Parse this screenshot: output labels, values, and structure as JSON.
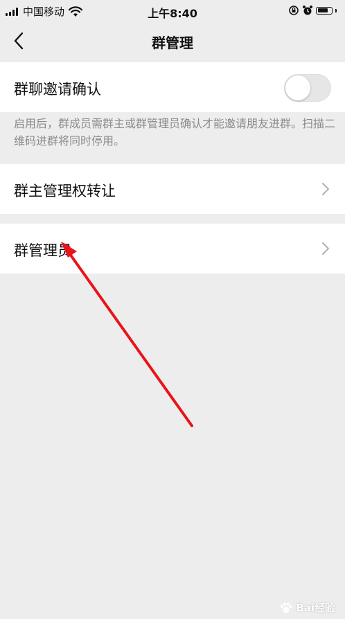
{
  "status_bar": {
    "carrier": "中国移动",
    "time": "上午8:40",
    "icons": [
      "signal-icon",
      "wifi-icon",
      "lock-rotation-icon",
      "alarm-icon",
      "battery-icon"
    ],
    "battery_level": 0.75
  },
  "nav": {
    "title": "群管理",
    "back_icon": "chevron-left-icon"
  },
  "settings": {
    "invite_confirm": {
      "label": "群聊邀请确认",
      "enabled": false
    },
    "invite_hint": "启用后，群成员需群主或群管理员确认才能邀请朋友进群。扫描二维码进群将同时停用。",
    "transfer_owner": {
      "label": "群主管理权转让"
    },
    "group_admins": {
      "label": "群管理员"
    }
  },
  "watermark": {
    "text": "Bai经验"
  },
  "colors": {
    "background": "#ededed",
    "cell": "#ffffff",
    "hint_text": "#8a8a8a",
    "annotation_arrow": "#e8141b",
    "toggle_off": "#e6e6e6"
  }
}
